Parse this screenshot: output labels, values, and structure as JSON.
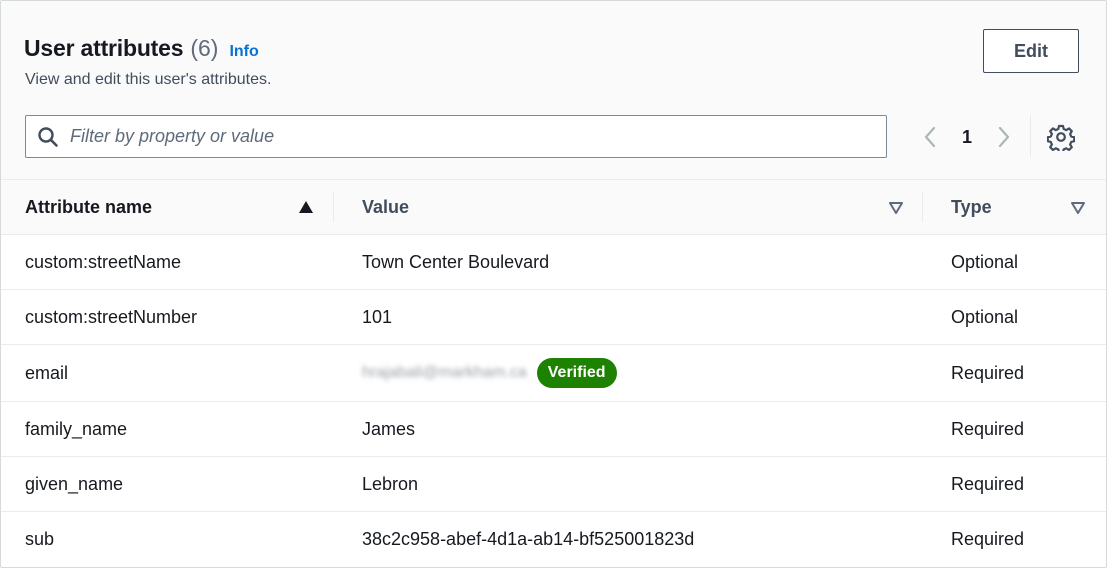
{
  "header": {
    "title": "User attributes",
    "count": "(6)",
    "info": "Info",
    "description": "View and edit this user's attributes.",
    "edit_label": "Edit"
  },
  "filter": {
    "placeholder": "Filter by property or value"
  },
  "pagination": {
    "current_page": "1"
  },
  "table": {
    "columns": [
      "Attribute name",
      "Value",
      "Type"
    ],
    "rows": [
      {
        "name": "custom:streetName",
        "value": "Town Center Boulevard",
        "type": "Optional"
      },
      {
        "name": "custom:streetNumber",
        "value": "101",
        "type": "Optional"
      },
      {
        "name": "email",
        "value": "hrajabali@markham.ca",
        "badge": "Verified",
        "type": "Required"
      },
      {
        "name": "family_name",
        "value": "James",
        "type": "Required"
      },
      {
        "name": "given_name",
        "value": "Lebron",
        "type": "Required"
      },
      {
        "name": "sub",
        "value": "38c2c958-abef-4d1a-ab14-bf525001823d",
        "type": "Required"
      }
    ]
  },
  "colors": {
    "link": "#0972d3",
    "badge": "#1d8102",
    "text": "#16191f"
  }
}
